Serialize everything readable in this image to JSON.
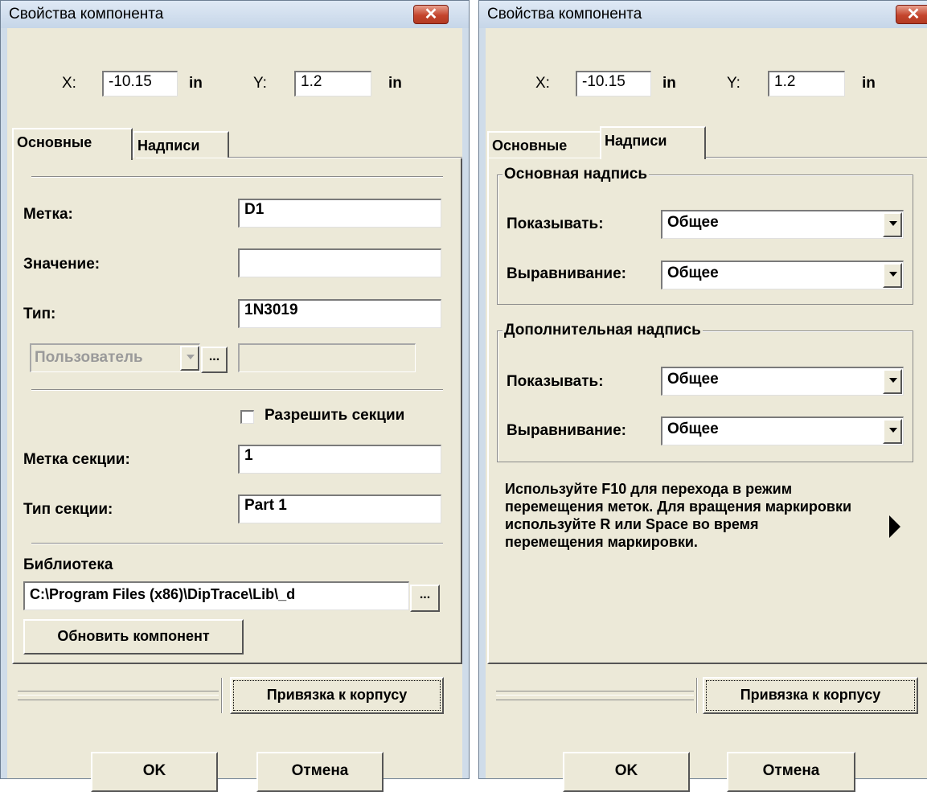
{
  "left_dialog": {
    "title": "Свойства компонента",
    "coords": {
      "x_label": "X:",
      "x_value": "-10.15",
      "x_unit": "in",
      "y_label": "Y:",
      "y_value": "1.2",
      "y_unit": "in"
    },
    "tabs": [
      "Основные",
      "Надписи"
    ],
    "fields": {
      "label_label": "Метка:",
      "label_value": "D1",
      "value_label": "Значение:",
      "value_value": "",
      "type_label": "Тип:",
      "type_value": "1N3019",
      "custom_select": "Пользователь",
      "custom_value": "",
      "allow_sections": "Разрешить секции",
      "section_label_label": "Метка секции:",
      "section_label_value": "1",
      "section_type_label": "Тип секции:",
      "section_type_value": "Part 1",
      "library_label": "Библиотека",
      "library_value": "C:\\Program Files (x86)\\DipTrace\\Lib\\_d",
      "update_button": "Обновить компонент"
    },
    "attach_button": "Привязка к корпусу",
    "ok": "OK",
    "cancel": "Отмена"
  },
  "right_dialog": {
    "title": "Свойства компонента",
    "coords": {
      "x_label": "X:",
      "x_value": "-10.15",
      "x_unit": "in",
      "y_label": "Y:",
      "y_value": "1.2",
      "y_unit": "in"
    },
    "tabs": [
      "Основные",
      "Надписи"
    ],
    "main_group": {
      "title": "Основная надпись",
      "show_label": "Показывать:",
      "show_value": "Общее",
      "align_label": "Выравнивание:",
      "align_value": "Общее"
    },
    "extra_group": {
      "title": "Дополнительная надпись",
      "show_label": "Показывать:",
      "show_value": "Общее",
      "align_label": "Выравнивание:",
      "align_value": "Общее"
    },
    "hint": "Используйте F10 для перехода в режим перемещения меток. Для вращения маркировки используйте R или Space во время перемещения маркировки.",
    "attach_button": "Привязка к корпусу",
    "ok": "OK",
    "cancel": "Отмена"
  },
  "icons": {
    "close": "close-icon",
    "dropdown": "chevron-down-icon",
    "hint_arrow": "play-arrow-icon"
  }
}
